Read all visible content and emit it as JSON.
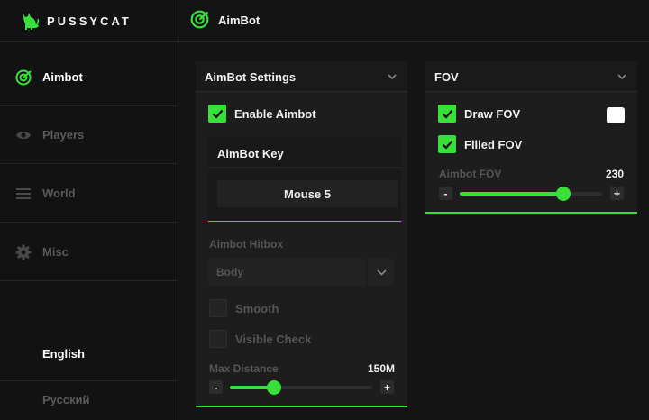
{
  "brand": {
    "name": "PUSSYCAT",
    "logo_icon": "cat-icon",
    "accent": "#39e039"
  },
  "sidebar": {
    "items": [
      {
        "label": "Aimbot",
        "icon": "radar-icon",
        "active": true
      },
      {
        "label": "Players",
        "icon": "eye-icon",
        "active": false
      },
      {
        "label": "World",
        "icon": "menu-icon",
        "active": false
      },
      {
        "label": "Misc",
        "icon": "gear-icon",
        "active": false
      }
    ],
    "languages": [
      {
        "label": "English",
        "active": true
      },
      {
        "label": "Русский",
        "active": false
      }
    ]
  },
  "header": {
    "title": "AimBot",
    "icon": "radar-icon"
  },
  "aimbot_panel": {
    "title": "AimBot Settings",
    "enable": {
      "label": "Enable Aimbot",
      "checked": true
    },
    "key": {
      "label": "AimBot Key",
      "value": "Mouse 5"
    },
    "hitbox": {
      "label": "Aimbot Hitbox",
      "value": "Body"
    },
    "smooth": {
      "label": "Smooth",
      "checked": false
    },
    "visible_check": {
      "label": "Visible Check",
      "checked": false
    },
    "max_distance": {
      "label": "Max Distance",
      "value": "150M",
      "fraction": 0.31,
      "minus": "-",
      "plus": "+"
    }
  },
  "fov_panel": {
    "title": "FOV",
    "draw_fov": {
      "label": "Draw FOV",
      "checked": true,
      "color": "#ffffff"
    },
    "filled_fov": {
      "label": "Filled FOV",
      "checked": true
    },
    "aimbot_fov": {
      "label": "Aimbot FOV",
      "value": "230",
      "fraction": 0.73,
      "minus": "-",
      "plus": "+"
    }
  }
}
